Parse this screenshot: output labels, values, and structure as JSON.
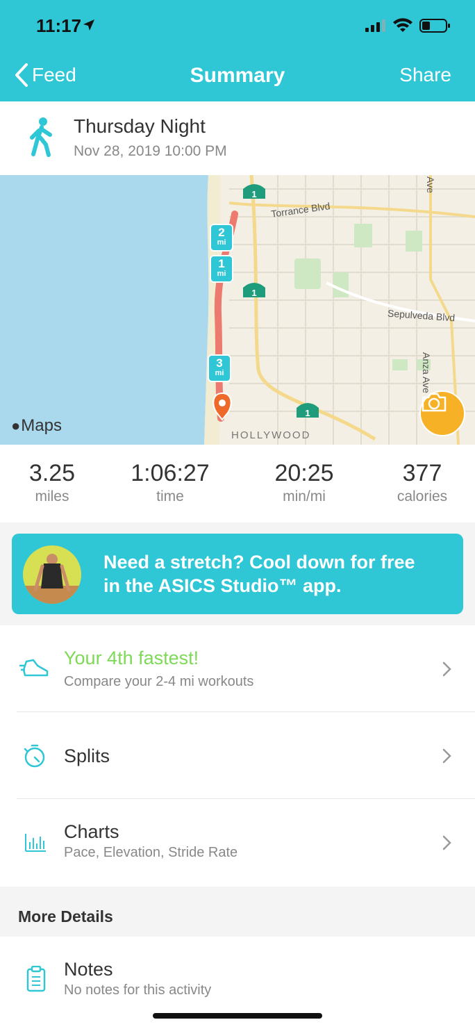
{
  "status_bar": {
    "time": "11:17"
  },
  "nav": {
    "back_label": "Feed",
    "title": "Summary",
    "share_label": "Share"
  },
  "activity": {
    "title": "Thursday Night",
    "date": "Nov 28, 2019 10:00 PM",
    "icon": "walking-person-icon"
  },
  "map": {
    "street_labels": [
      "Torrance Blvd",
      "Sepulveda Blvd",
      "Anza Ave",
      "Ave"
    ],
    "area_label": "HOLLYWOOD",
    "route_markers": [
      {
        "value": "2",
        "unit": "mi"
      },
      {
        "value": "1",
        "unit": "mi"
      },
      {
        "value": "3",
        "unit": "mi"
      }
    ],
    "highway_shield": "1",
    "attribution": "Maps",
    "accent_color": "#f6b126"
  },
  "stats": [
    {
      "value": "3.25",
      "unit": "miles"
    },
    {
      "value": "1:06:27",
      "unit": "time"
    },
    {
      "value": "20:25",
      "unit": "min/mi"
    },
    {
      "value": "377",
      "unit": "calories"
    }
  ],
  "promo": {
    "line1": "Need a stretch? Cool down for free",
    "line2": "in the ASICS Studio™ app."
  },
  "rows": {
    "fastest": {
      "title": "Your 4th fastest!",
      "subtitle": "Compare your 2-4 mi workouts",
      "title_color": "#7ed957"
    },
    "splits": {
      "title": "Splits"
    },
    "charts": {
      "title": "Charts",
      "subtitle": "Pace, Elevation, Stride Rate"
    }
  },
  "more_details": {
    "header": "More Details"
  },
  "notes": {
    "title": "Notes",
    "subtitle": "No notes for this activity"
  },
  "theme": {
    "primary": "#2fc6d6"
  }
}
